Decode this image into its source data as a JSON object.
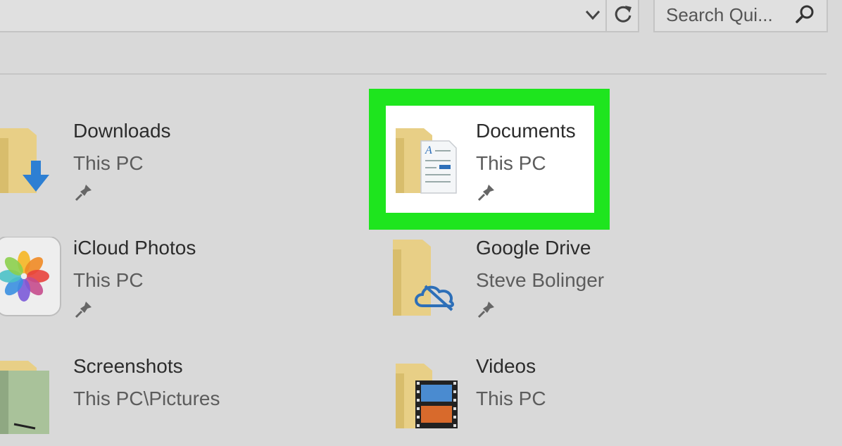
{
  "toolbar": {
    "chevron_icon": "chevron-down-icon",
    "refresh_icon": "refresh-icon",
    "search_placeholder": "Search Qui...",
    "search_icon": "search-icon"
  },
  "quick_access": {
    "items": [
      {
        "name": "Downloads",
        "location": "This PC",
        "icon": "downloads-folder-icon",
        "pinned": true
      },
      {
        "name": "Documents",
        "location": "This PC",
        "icon": "documents-folder-icon",
        "pinned": true,
        "highlighted": true
      },
      {
        "name": "iCloud Photos",
        "location": "This PC",
        "icon": "icloud-photos-icon",
        "pinned": true
      },
      {
        "name": "Google Drive",
        "location": "Steve Bolinger",
        "icon": "google-drive-folder-icon",
        "pinned": true
      },
      {
        "name": "Screenshots",
        "location": "This PC\\Pictures",
        "icon": "screenshots-folder-icon",
        "pinned": false
      },
      {
        "name": "Videos",
        "location": "This PC",
        "icon": "videos-folder-icon",
        "pinned": false
      }
    ]
  },
  "colors": {
    "background": "#d9d9d9",
    "highlight": "#1ee51e",
    "folder": "#e8cf86",
    "download_arrow": "#2d7fd3"
  }
}
